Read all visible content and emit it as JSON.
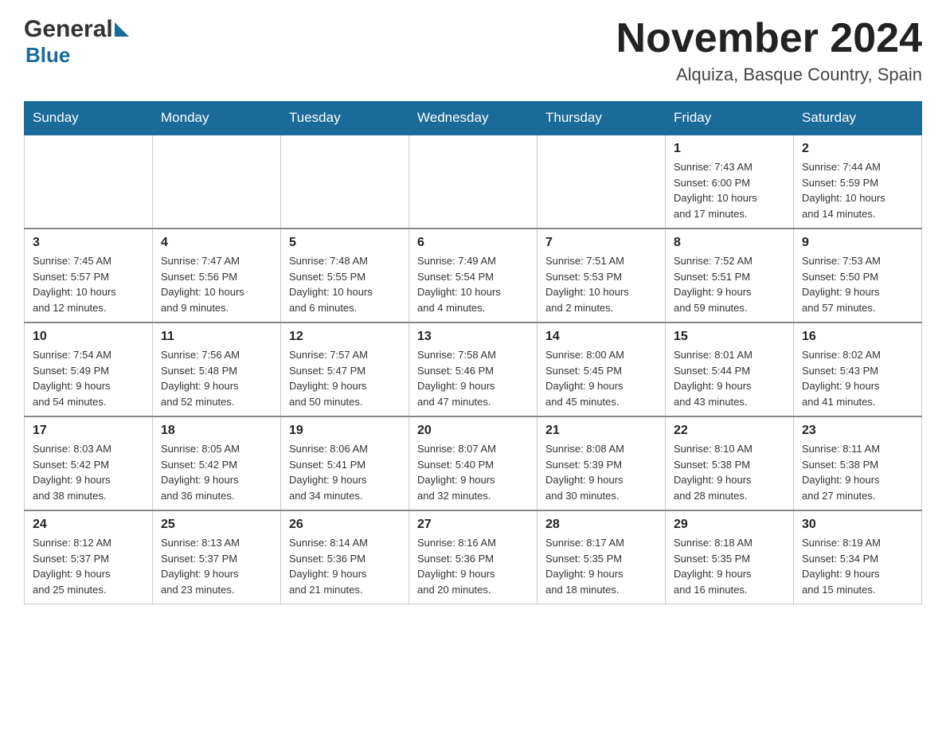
{
  "header": {
    "logo": {
      "general": "General",
      "blue": "Blue"
    },
    "title": "November 2024",
    "location": "Alquiza, Basque Country, Spain"
  },
  "calendar": {
    "days_of_week": [
      "Sunday",
      "Monday",
      "Tuesday",
      "Wednesday",
      "Thursday",
      "Friday",
      "Saturday"
    ],
    "weeks": [
      [
        {
          "day": "",
          "info": ""
        },
        {
          "day": "",
          "info": ""
        },
        {
          "day": "",
          "info": ""
        },
        {
          "day": "",
          "info": ""
        },
        {
          "day": "",
          "info": ""
        },
        {
          "day": "1",
          "info": "Sunrise: 7:43 AM\nSunset: 6:00 PM\nDaylight: 10 hours\nand 17 minutes."
        },
        {
          "day": "2",
          "info": "Sunrise: 7:44 AM\nSunset: 5:59 PM\nDaylight: 10 hours\nand 14 minutes."
        }
      ],
      [
        {
          "day": "3",
          "info": "Sunrise: 7:45 AM\nSunset: 5:57 PM\nDaylight: 10 hours\nand 12 minutes."
        },
        {
          "day": "4",
          "info": "Sunrise: 7:47 AM\nSunset: 5:56 PM\nDaylight: 10 hours\nand 9 minutes."
        },
        {
          "day": "5",
          "info": "Sunrise: 7:48 AM\nSunset: 5:55 PM\nDaylight: 10 hours\nand 6 minutes."
        },
        {
          "day": "6",
          "info": "Sunrise: 7:49 AM\nSunset: 5:54 PM\nDaylight: 10 hours\nand 4 minutes."
        },
        {
          "day": "7",
          "info": "Sunrise: 7:51 AM\nSunset: 5:53 PM\nDaylight: 10 hours\nand 2 minutes."
        },
        {
          "day": "8",
          "info": "Sunrise: 7:52 AM\nSunset: 5:51 PM\nDaylight: 9 hours\nand 59 minutes."
        },
        {
          "day": "9",
          "info": "Sunrise: 7:53 AM\nSunset: 5:50 PM\nDaylight: 9 hours\nand 57 minutes."
        }
      ],
      [
        {
          "day": "10",
          "info": "Sunrise: 7:54 AM\nSunset: 5:49 PM\nDaylight: 9 hours\nand 54 minutes."
        },
        {
          "day": "11",
          "info": "Sunrise: 7:56 AM\nSunset: 5:48 PM\nDaylight: 9 hours\nand 52 minutes."
        },
        {
          "day": "12",
          "info": "Sunrise: 7:57 AM\nSunset: 5:47 PM\nDaylight: 9 hours\nand 50 minutes."
        },
        {
          "day": "13",
          "info": "Sunrise: 7:58 AM\nSunset: 5:46 PM\nDaylight: 9 hours\nand 47 minutes."
        },
        {
          "day": "14",
          "info": "Sunrise: 8:00 AM\nSunset: 5:45 PM\nDaylight: 9 hours\nand 45 minutes."
        },
        {
          "day": "15",
          "info": "Sunrise: 8:01 AM\nSunset: 5:44 PM\nDaylight: 9 hours\nand 43 minutes."
        },
        {
          "day": "16",
          "info": "Sunrise: 8:02 AM\nSunset: 5:43 PM\nDaylight: 9 hours\nand 41 minutes."
        }
      ],
      [
        {
          "day": "17",
          "info": "Sunrise: 8:03 AM\nSunset: 5:42 PM\nDaylight: 9 hours\nand 38 minutes."
        },
        {
          "day": "18",
          "info": "Sunrise: 8:05 AM\nSunset: 5:42 PM\nDaylight: 9 hours\nand 36 minutes."
        },
        {
          "day": "19",
          "info": "Sunrise: 8:06 AM\nSunset: 5:41 PM\nDaylight: 9 hours\nand 34 minutes."
        },
        {
          "day": "20",
          "info": "Sunrise: 8:07 AM\nSunset: 5:40 PM\nDaylight: 9 hours\nand 32 minutes."
        },
        {
          "day": "21",
          "info": "Sunrise: 8:08 AM\nSunset: 5:39 PM\nDaylight: 9 hours\nand 30 minutes."
        },
        {
          "day": "22",
          "info": "Sunrise: 8:10 AM\nSunset: 5:38 PM\nDaylight: 9 hours\nand 28 minutes."
        },
        {
          "day": "23",
          "info": "Sunrise: 8:11 AM\nSunset: 5:38 PM\nDaylight: 9 hours\nand 27 minutes."
        }
      ],
      [
        {
          "day": "24",
          "info": "Sunrise: 8:12 AM\nSunset: 5:37 PM\nDaylight: 9 hours\nand 25 minutes."
        },
        {
          "day": "25",
          "info": "Sunrise: 8:13 AM\nSunset: 5:37 PM\nDaylight: 9 hours\nand 23 minutes."
        },
        {
          "day": "26",
          "info": "Sunrise: 8:14 AM\nSunset: 5:36 PM\nDaylight: 9 hours\nand 21 minutes."
        },
        {
          "day": "27",
          "info": "Sunrise: 8:16 AM\nSunset: 5:36 PM\nDaylight: 9 hours\nand 20 minutes."
        },
        {
          "day": "28",
          "info": "Sunrise: 8:17 AM\nSunset: 5:35 PM\nDaylight: 9 hours\nand 18 minutes."
        },
        {
          "day": "29",
          "info": "Sunrise: 8:18 AM\nSunset: 5:35 PM\nDaylight: 9 hours\nand 16 minutes."
        },
        {
          "day": "30",
          "info": "Sunrise: 8:19 AM\nSunset: 5:34 PM\nDaylight: 9 hours\nand 15 minutes."
        }
      ]
    ]
  }
}
